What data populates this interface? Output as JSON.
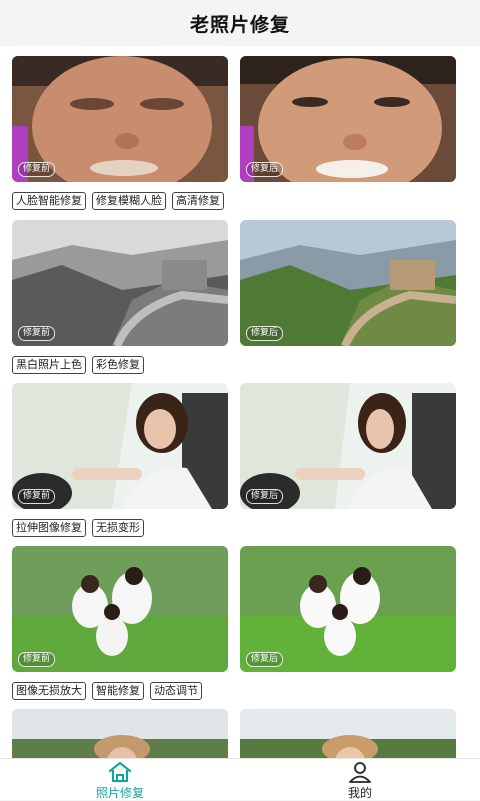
{
  "header": {
    "title": "老照片修复"
  },
  "sections": [
    {
      "before_badge": "修复前",
      "after_badge": "修复后",
      "tags": [
        "人脸智能修复",
        "修复模糊人脸",
        "高清修复"
      ]
    },
    {
      "before_badge": "修复前",
      "after_badge": "修复后",
      "tags": [
        "黑白照片上色",
        "彩色修复"
      ]
    },
    {
      "before_badge": "修复前",
      "after_badge": "修复后",
      "tags": [
        "拉伸图像修复",
        "无损变形"
      ]
    },
    {
      "before_badge": "修复前",
      "after_badge": "修复后",
      "tags": [
        "图像无损放大",
        "智能修复",
        "动态调节"
      ]
    }
  ],
  "tabbar": {
    "home_label": "照片修复",
    "home_icon": "home-icon",
    "mine_label": "我的",
    "mine_icon": "user-icon",
    "active_color": "#17a59b"
  }
}
